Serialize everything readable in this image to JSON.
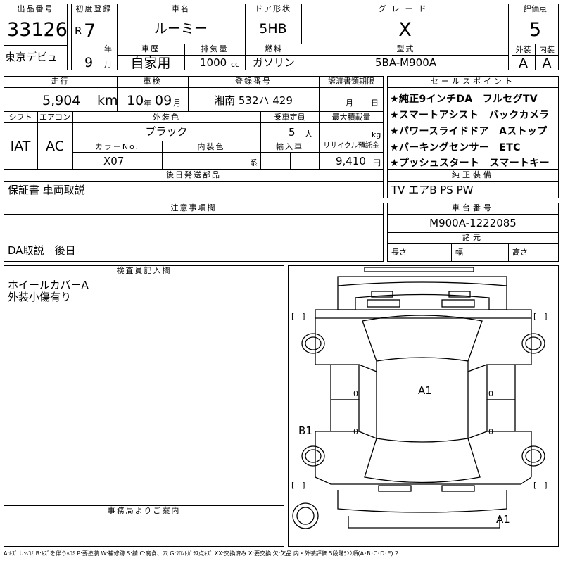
{
  "header": {
    "lot_label": "出品番号",
    "lot_number": "33126",
    "venue": "東京デビュ",
    "first_reg_label": "初度登録",
    "era": "R",
    "year": "7",
    "year_unit": "年",
    "month": "9",
    "month_unit": "月",
    "car_name_label": "車名",
    "car_name": "ルーミー",
    "door_label": "ドア形状",
    "door": "5HB",
    "grade_label": "グレード",
    "grade": "X",
    "score_label": "評価点",
    "score": "5",
    "history_label": "車歴",
    "history": "自家用",
    "displacement_label": "排気量",
    "displacement": "1000",
    "displacement_unit": "cc",
    "fuel_label": "燃料",
    "fuel": "ガソリン",
    "model_label": "型式",
    "model": "5BA-M900A",
    "exterior_label": "外装",
    "exterior": "A",
    "interior_label": "内装",
    "interior": "A"
  },
  "details": {
    "mileage_label": "走行",
    "mileage": "5,904",
    "mileage_unit": "km",
    "inspection_label": "車検",
    "inspection_year": "10",
    "inspection_year_unit": "年",
    "inspection_month": "09",
    "inspection_month_unit": "月",
    "plate_label": "登録番号",
    "plate": "湘南 532ハ 429",
    "transfer_label": "譲渡書類期限",
    "transfer_month_unit": "月",
    "transfer_day_unit": "日",
    "shift_label": "シフト",
    "shift": "IAT",
    "ac_label": "エアコン",
    "ac": "AC",
    "ext_color_label": "外装色",
    "ext_color": "ブラック",
    "capacity_label": "乗車定員",
    "capacity": "5",
    "capacity_unit": "人",
    "max_load_label": "最大積載量",
    "max_load_unit": "kg",
    "color_no_label": "カラーNo.",
    "color_no": "X07",
    "int_color_label": "内装色",
    "int_color_unit": "系",
    "import_label": "輸入車",
    "recycle_label": "リサイクル預託金",
    "recycle": "9,410",
    "recycle_unit": "円"
  },
  "sales_points": {
    "label": "セールスポイント",
    "items": [
      "★純正9インチDA　フルセグTV",
      "★スマートアシスト　バックカメラ",
      "★パワースライドドア　Aストップ",
      "★パーキングセンサー　ETC",
      "★プッシュスタート　スマートキー"
    ]
  },
  "later_parts": {
    "label": "後日発送部品",
    "value": "保証書 車両取説"
  },
  "equipment": {
    "label": "純正装備",
    "value": "TV エアB PS PW"
  },
  "notes": {
    "label": "注意事項欄",
    "value": "DA取説　後日"
  },
  "chassis": {
    "label": "車台番号",
    "value": "M900A-1222085",
    "specs_label": "諸元",
    "length_label": "長さ",
    "width_label": "幅",
    "height_label": "高さ"
  },
  "inspector": {
    "label": "検査員記入欄",
    "line1": "ホイールカバーA",
    "line2": "外装小傷有り"
  },
  "office": {
    "label": "事務局よりご案内"
  },
  "diagram": {
    "mark_a1_center": "A1",
    "mark_b1": "B1",
    "mark_a1_bottom": "A1",
    "zero": "0",
    "bracket": "[　]"
  },
  "legend": "A:ｷｽﾞ U:ﾍｺﾐ B:ｷｽﾞを伴うﾍｺﾐ P:要塗装 W:補修跡 S:錆 C:腐食、穴 G:ﾌﾛﾝﾄｶﾞﾗｽ点ｷｽﾞ XX:交換済み X:要交換 欠:欠品 内・外装評価 5段階ﾗﾝｸ順(A･B･C･D･E) 2"
}
